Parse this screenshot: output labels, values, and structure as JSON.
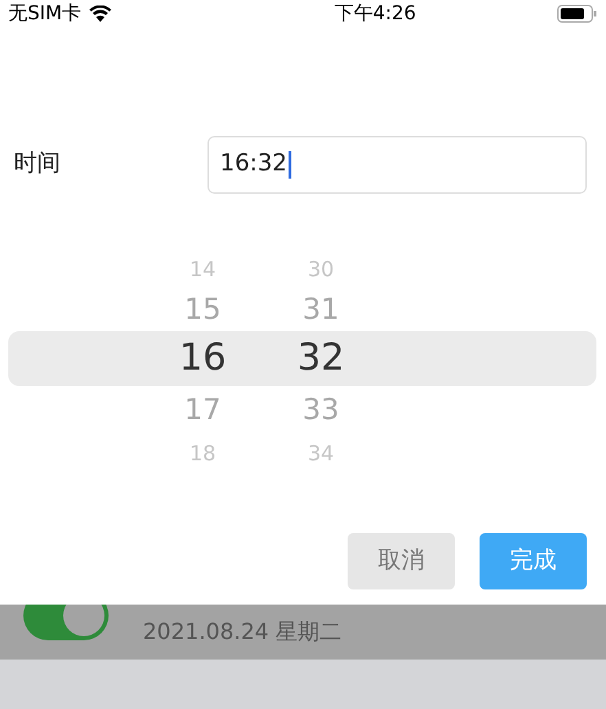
{
  "status_bar": {
    "carrier": "无SIM卡",
    "time": "下午4:26"
  },
  "form": {
    "label": "时间",
    "value": "16:32"
  },
  "picker": {
    "columns": [
      {
        "items": [
          {
            "label": "14",
            "selected": false
          },
          {
            "label": "15",
            "selected": false
          },
          {
            "label": "16",
            "selected": true
          },
          {
            "label": "17",
            "selected": false
          },
          {
            "label": "18",
            "selected": false
          }
        ]
      },
      {
        "items": [
          {
            "label": "30",
            "selected": false
          },
          {
            "label": "31",
            "selected": false
          },
          {
            "label": "32",
            "selected": true
          },
          {
            "label": "33",
            "selected": false
          },
          {
            "label": "34",
            "selected": false
          }
        ]
      }
    ]
  },
  "buttons": [
    {
      "label": "取消",
      "kind": "secondary"
    },
    {
      "label": "完成",
      "kind": "primary"
    }
  ],
  "background_row": {
    "toggle_on": true,
    "date": "2021.08.24 星期二"
  }
}
